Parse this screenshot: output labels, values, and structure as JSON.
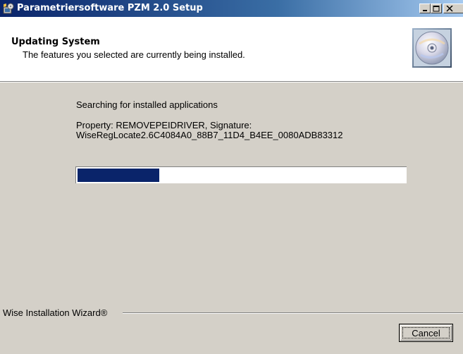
{
  "window": {
    "title": "Parametriersoftware PZM 2.0 Setup",
    "icons": {
      "app": "installer-icon",
      "minimize": "minimize-icon",
      "maximize": "maximize-icon",
      "close": "close-icon"
    }
  },
  "header": {
    "title": "Updating System",
    "subtitle": "The features you selected are currently being installed.",
    "graphic": "cd-disc-icon"
  },
  "main": {
    "status": "Searching for installed applications",
    "detail_line1": "Property: REMOVEPEIDRIVER, Signature:",
    "detail_line2": "WiseRegLocate2.6C4084A0_88B7_11D4_B4EE_0080ADB83312",
    "progress_fraction": 0.25
  },
  "footer": {
    "wizard_label": "Wise Installation Wizard®",
    "cancel_label": "Cancel"
  },
  "colors": {
    "titlebar_start": "#0a246a",
    "titlebar_end": "#a6caf0",
    "progress_fill": "#0a246a",
    "dialog_bg": "#d4d0c8"
  }
}
